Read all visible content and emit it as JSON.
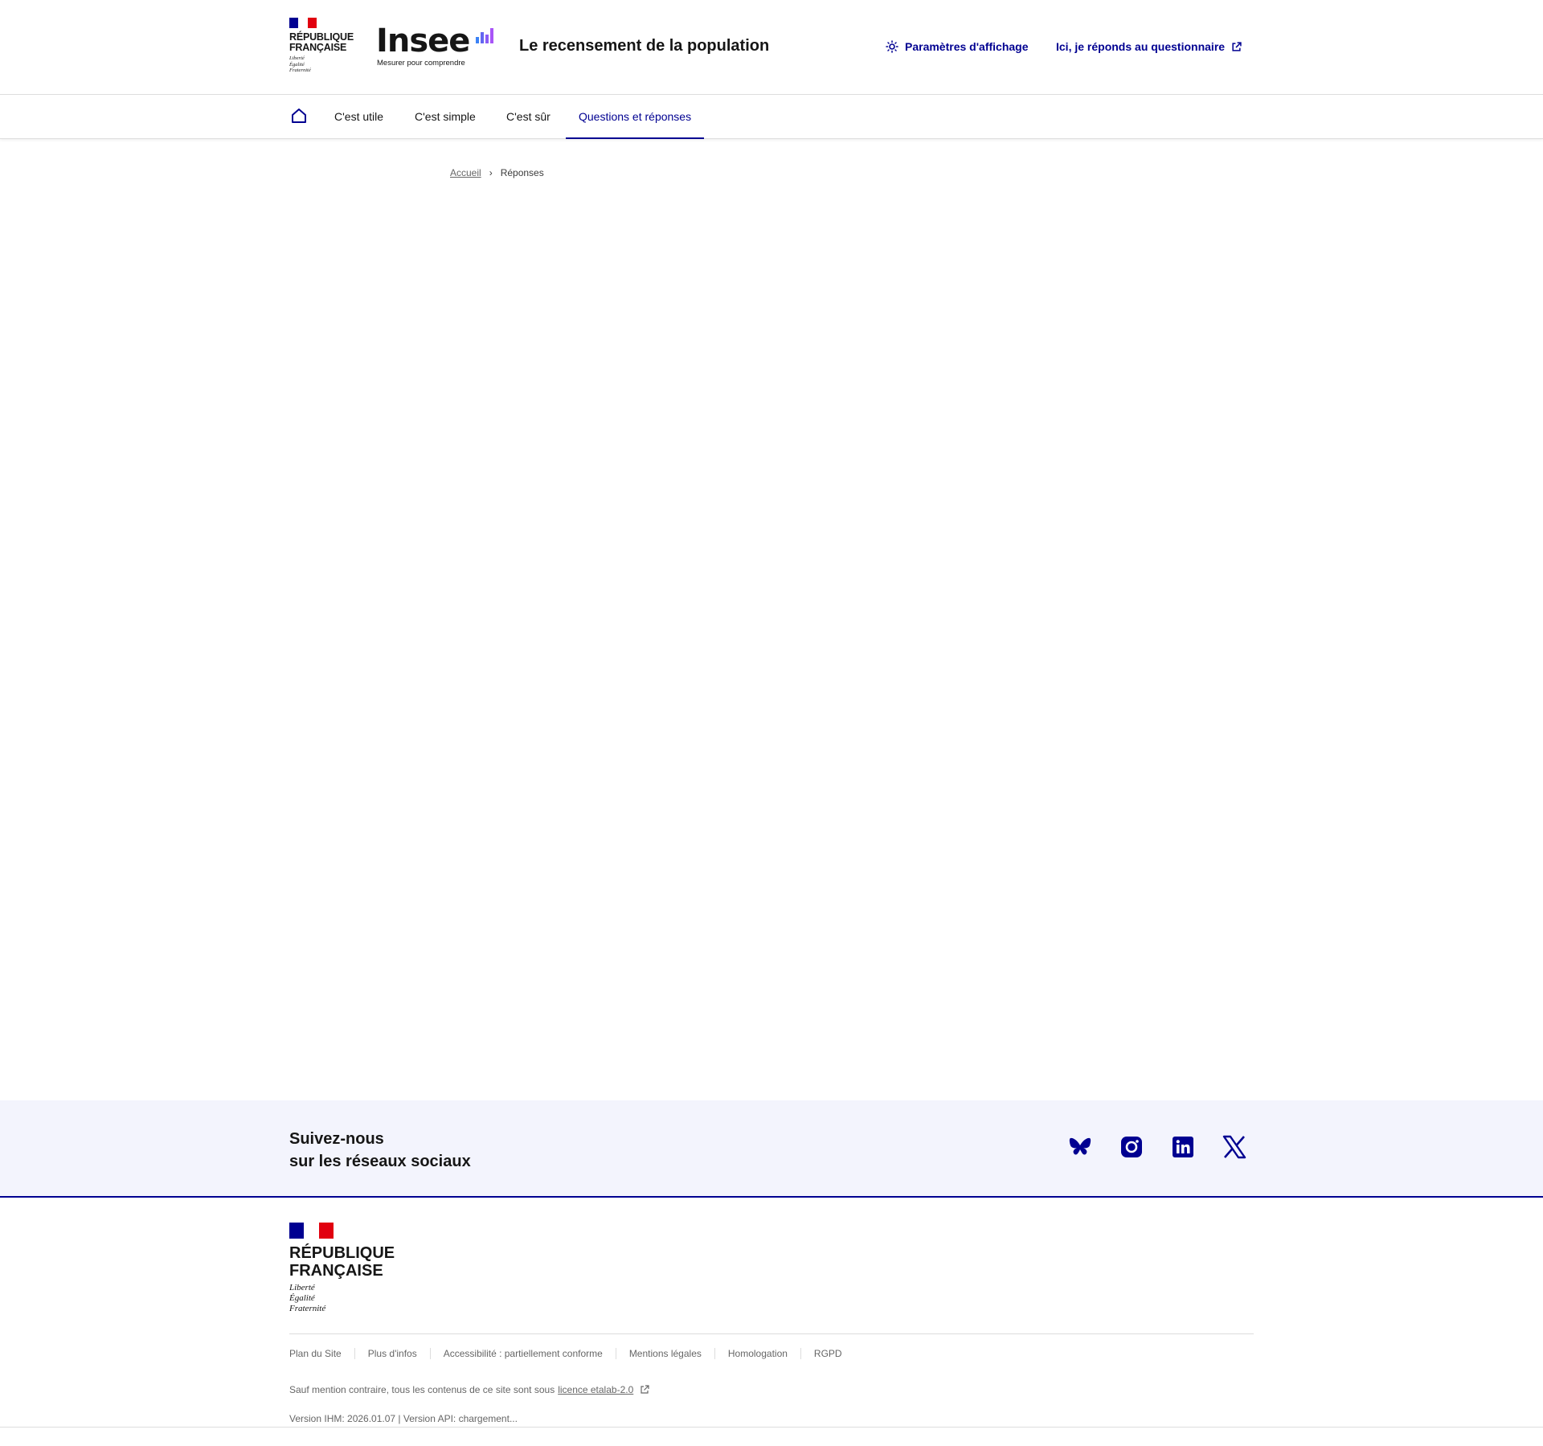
{
  "header": {
    "brand": {
      "name_line1": "RÉPUBLIQUE",
      "name_line2": "FRANÇAISE",
      "motto": [
        "Liberté",
        "Égalité",
        "Fraternité"
      ]
    },
    "insee": {
      "logo_text": "Insee",
      "tagline": "Mesurer pour comprendre",
      "bar_colors": [
        "#3b82f6",
        "#6366f1",
        "#a855f7"
      ]
    },
    "site_title": "Le recensement de la population",
    "tools": {
      "display_settings": "Paramètres d'affichage",
      "answer_questionnaire": "Ici, je réponds au questionnaire"
    }
  },
  "nav": {
    "items": [
      {
        "label": "C'est utile",
        "active": false
      },
      {
        "label": "C'est simple",
        "active": false
      },
      {
        "label": "C'est sûr",
        "active": false
      },
      {
        "label": "Questions et réponses",
        "active": true
      }
    ]
  },
  "breadcrumb": {
    "home": "Accueil",
    "current": "Réponses"
  },
  "follow": {
    "title_line1": "Suivez-nous",
    "title_line2": "sur les réseaux sociaux",
    "networks": [
      "bluesky-icon",
      "instagram-icon",
      "linkedin-icon",
      "x-icon"
    ]
  },
  "footer": {
    "links": [
      "Plan du Site",
      "Plus d'infos",
      "Accessibilité : partiellement conforme",
      "Mentions légales",
      "Homologation",
      "RGPD"
    ],
    "license_text": "Sauf mention contraire, tous les contenus de ce site sont sous",
    "license_link": "licence etalab-2.0",
    "version": "Version IHM: 2026.01.07 | Version API: chargement..."
  },
  "colors": {
    "primary_blue": "#000091",
    "flag_red": "#e1000f",
    "follow_bg": "#f3f4fd",
    "muted_text": "#666666"
  }
}
